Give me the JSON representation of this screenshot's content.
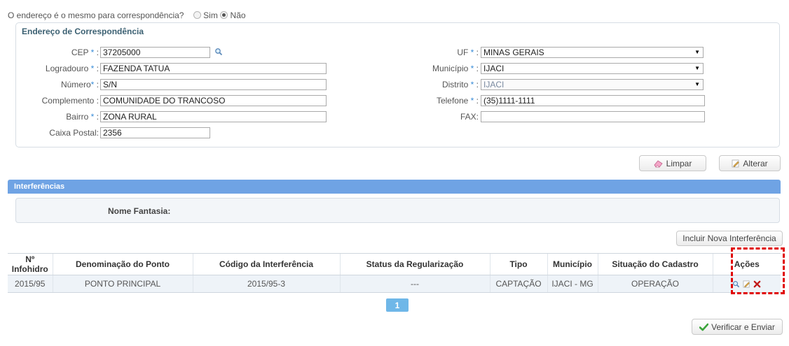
{
  "question": {
    "text": "O endereço é o mesmo para correspondência?",
    "options": [
      "Sim",
      "Não"
    ],
    "selected": "Não"
  },
  "address": {
    "title": "Endereço de Correspondência",
    "labels": {
      "cep": "CEP",
      "logradouro": "Logradouro",
      "numero": "Número",
      "complemento": "Complemento",
      "bairro": "Bairro",
      "caixa_postal": "Caixa Postal",
      "uf": "UF",
      "municipio": "Município",
      "distrito": "Distrito",
      "telefone": "Telefone",
      "fax": "FAX"
    },
    "values": {
      "cep": "37205000",
      "logradouro": "FAZENDA TATUA",
      "numero": "S/N",
      "complemento": "COMUNIDADE DO TRANCOSO",
      "bairro": "ZONA RURAL",
      "caixa_postal": "2356",
      "uf": "MINAS GERAIS",
      "municipio": "IJACI",
      "distrito": "IJACI",
      "telefone": "(35)1111-1111",
      "fax": ""
    },
    "required_mark": "*"
  },
  "actions": {
    "clear": "Limpar",
    "change": "Alterar"
  },
  "interferences": {
    "section_title": "Interferências",
    "nome_fantasia_label": "Nome Fantasia:",
    "add_button": "Incluir Nova Interferência",
    "columns": [
      "Nº Infohidro",
      "Denominação do Ponto",
      "Código da Interferência",
      "Status da Regularização",
      "Tipo",
      "Município",
      "Situação do Cadastro",
      "Ações"
    ],
    "rows": [
      [
        "2015/95",
        "PONTO PRINCIPAL",
        "2015/95-3",
        "---",
        "CAPTAÇÃO",
        "IJACI - MG",
        "OPERAÇÃO"
      ]
    ],
    "current_page": "1"
  },
  "submit": "Verificar e Enviar",
  "colors": {
    "header_bar": "#6fa3e4",
    "required": "#3a8dd8",
    "highlight": "#e00000",
    "check": "#3aa43a"
  }
}
